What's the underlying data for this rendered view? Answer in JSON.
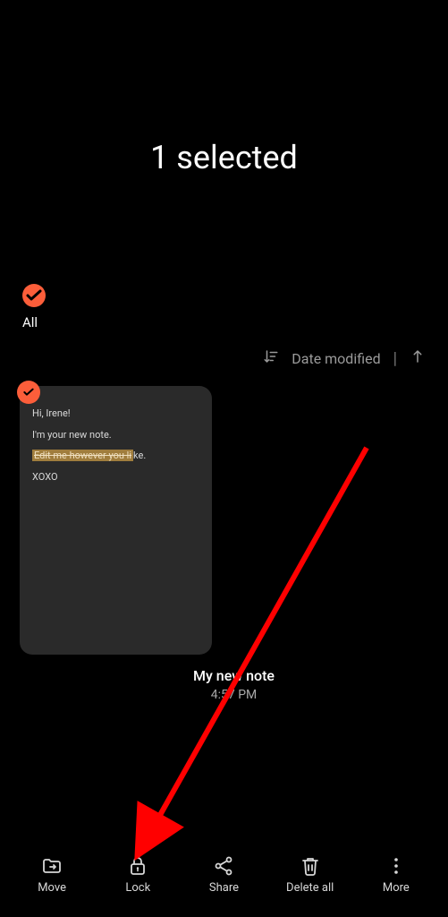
{
  "header": {
    "title": "1 selected"
  },
  "select_all": {
    "label": "All"
  },
  "sort": {
    "label": "Date modified"
  },
  "notes": [
    {
      "lines": {
        "l1": "Hi, Irene!",
        "l2": "I'm your new note.",
        "l3_highlighted": "Edit me however you li",
        "l3_rest": "ke.",
        "l4": "XOXO"
      },
      "title": "My new note",
      "time": "4:57 PM"
    }
  ],
  "toolbar": {
    "move": "Move",
    "lock": "Lock",
    "share": "Share",
    "delete_all": "Delete all",
    "more": "More"
  },
  "colors": {
    "accent": "#fc5e3a",
    "arrow": "#ff0000"
  }
}
